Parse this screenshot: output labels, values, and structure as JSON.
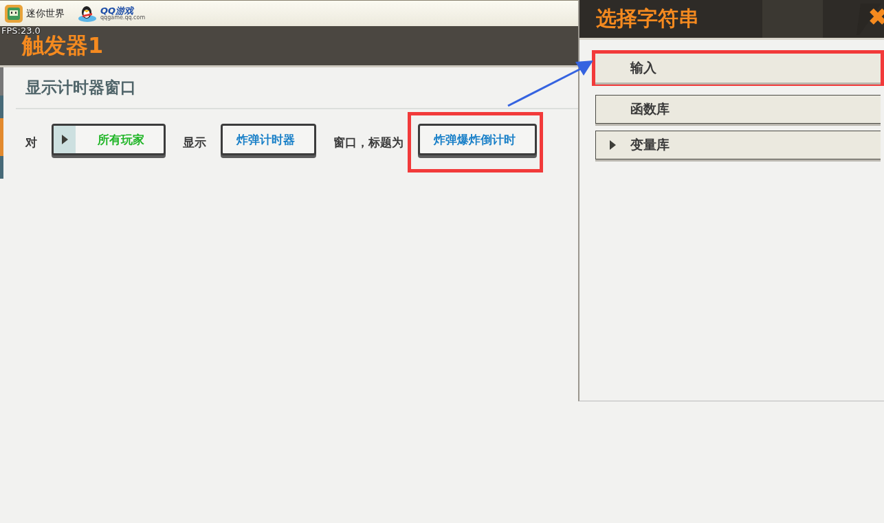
{
  "app_bar": {
    "app_name": "迷你世界",
    "platform_name": "QQ游戏",
    "platform_url": "qqgame.qq.com"
  },
  "fps": "FPS:23.0",
  "editor": {
    "title": "触发器1",
    "action_title": "显示计时器窗口",
    "sentence": [
      {
        "kind": "text",
        "text": "对"
      },
      {
        "kind": "param",
        "text": "所有玩家",
        "color": "#1fb526",
        "expandable": true,
        "highlighted": false
      },
      {
        "kind": "text",
        "text": "显示"
      },
      {
        "kind": "param",
        "text": "炸弹计时器",
        "color": "#1a80c8",
        "expandable": false,
        "highlighted": false
      },
      {
        "kind": "text",
        "text": "窗口，标题为"
      },
      {
        "kind": "param",
        "text": "炸弹爆炸倒计时",
        "color": "#1a80c8",
        "expandable": false,
        "highlighted": true
      }
    ]
  },
  "picker": {
    "title": "选择字符串",
    "options": [
      {
        "label": "输入",
        "expandable": false,
        "highlighted": true
      },
      {
        "label": "函数库",
        "expandable": false,
        "highlighted": false
      },
      {
        "label": "变量库",
        "expandable": true,
        "highlighted": false
      }
    ]
  }
}
